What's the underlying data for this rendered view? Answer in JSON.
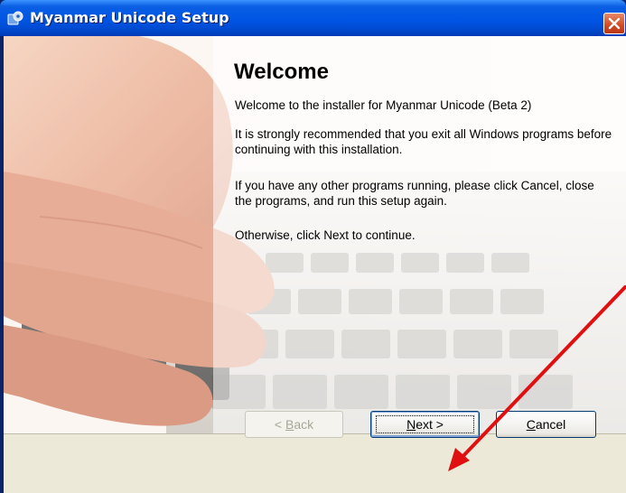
{
  "window": {
    "title": "Myanmar Unicode Setup",
    "icon": "installer-app-icon",
    "close_icon": "close-icon"
  },
  "content": {
    "heading": "Welcome",
    "paragraphs": [
      "Welcome to the installer for Myanmar Unicode (Beta 2)",
      "It is strongly recommended that you exit all Windows programs before continuing with this installation.",
      "If you have any other programs running, please click Cancel, close the programs, and run this setup again.",
      "Otherwise, click Next to continue."
    ]
  },
  "buttons": {
    "back": {
      "label_pre": "< ",
      "label_accel": "B",
      "label_post": "ack",
      "enabled": false
    },
    "next": {
      "label_pre": "",
      "label_accel": "N",
      "label_post": "ext >",
      "focused": true
    },
    "cancel": {
      "label_pre": "",
      "label_accel": "C",
      "label_post": "ancel"
    }
  },
  "annotation": {
    "type": "arrow",
    "color": "#e01010"
  }
}
